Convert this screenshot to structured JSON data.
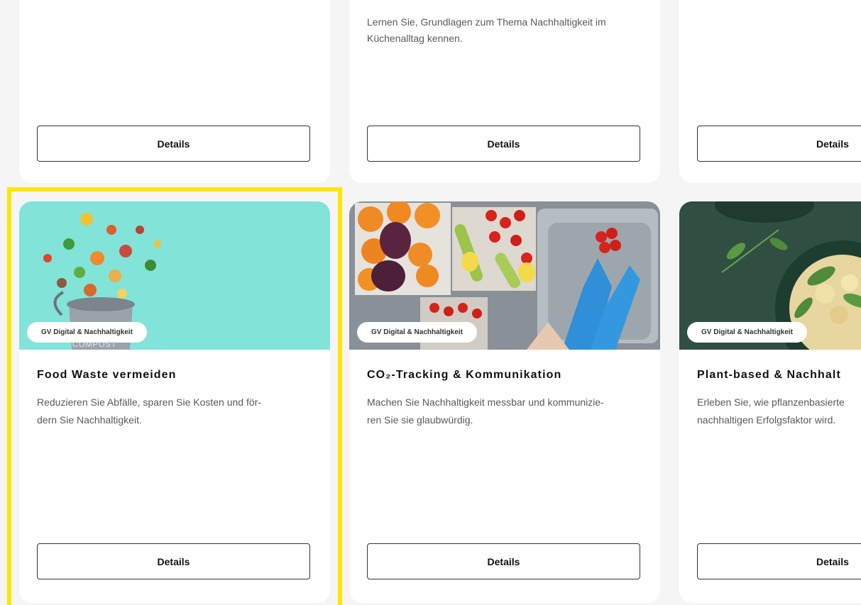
{
  "cards_top": [
    {
      "description": "",
      "button_label": "Details"
    },
    {
      "description": "Lernen Sie, Grundlagen zum Thema Nachhaltigkeit im Küchenalltag kennen.",
      "button_label": "Details"
    },
    {
      "description": "",
      "button_label": "Details"
    }
  ],
  "cards_bottom": [
    {
      "category": "GV Digital & Nachhaltigkeit",
      "image_label": "COMPOST",
      "title": "Food Waste vermeiden",
      "description": "Reduzieren Sie Abfälle, sparen Sie Kosten und för-\ndern Sie Nachhaltigkeit.",
      "button_label": "Details"
    },
    {
      "category": "GV Digital & Nachhaltigkeit",
      "title": "CO₂-Tracking & Kommunikation",
      "description": "Machen Sie Nachhaltigkeit messbar und kommunizie-\nren Sie sie glaubwürdig.",
      "button_label": "Details"
    },
    {
      "category": "GV Digital & Nachhaltigkeit",
      "title": "Plant-based & Nachhalt",
      "description": "Erleben Sie, wie pflanzenbasierte\nnachhaltigen Erfolgsfaktor wird.",
      "button_label": "Details"
    }
  ],
  "colors": {
    "highlight": "#ffe600",
    "compost_bg": "#7fe0d6",
    "dark_green": "#2c4a3e"
  }
}
